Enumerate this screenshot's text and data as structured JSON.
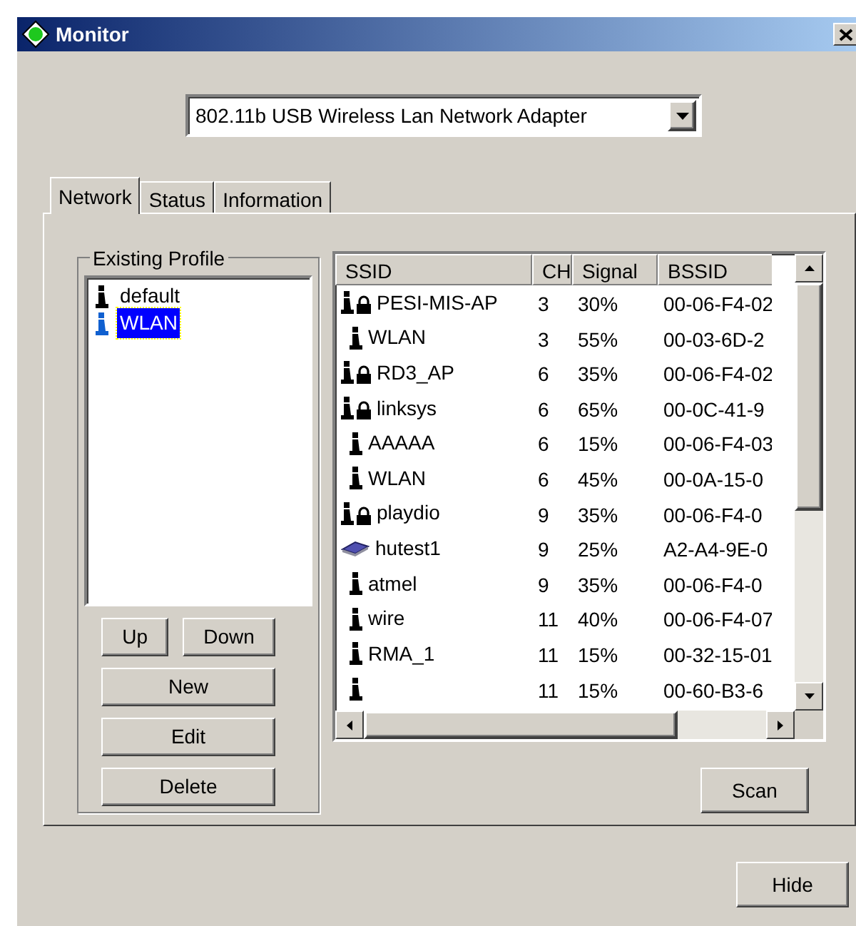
{
  "window": {
    "title": "Monitor"
  },
  "adapter": {
    "value": "802.11b USB Wireless Lan Network Adapter"
  },
  "tabs": [
    {
      "label": "Network",
      "selected": true
    },
    {
      "label": "Status",
      "selected": false
    },
    {
      "label": "Information",
      "selected": false
    }
  ],
  "profiles": {
    "title": "Existing Profile",
    "items": [
      {
        "name": "default",
        "selected": false
      },
      {
        "name": "WLAN",
        "selected": true
      }
    ],
    "buttons": [
      "Up",
      "Down",
      "New",
      "Edit",
      "Delete"
    ]
  },
  "networks": {
    "columns": [
      "SSID",
      "CH",
      "Signal",
      "BSSID"
    ],
    "rows": [
      {
        "kind": "secure",
        "ssid": "PESI-MIS-AP",
        "ch": "3",
        "signal": "30%",
        "bssid": "00-06-F4-02"
      },
      {
        "kind": "open",
        "ssid": "WLAN",
        "ch": "3",
        "signal": "55%",
        "bssid": "00-03-6D-2"
      },
      {
        "kind": "secure",
        "ssid": "RD3_AP",
        "ch": "6",
        "signal": "35%",
        "bssid": "00-06-F4-02"
      },
      {
        "kind": "secure",
        "ssid": "linksys",
        "ch": "6",
        "signal": "65%",
        "bssid": "00-0C-41-9"
      },
      {
        "kind": "open",
        "ssid": "AAAAA",
        "ch": "6",
        "signal": "15%",
        "bssid": "00-06-F4-03"
      },
      {
        "kind": "open",
        "ssid": "WLAN",
        "ch": "6",
        "signal": "45%",
        "bssid": "00-0A-15-0"
      },
      {
        "kind": "secure",
        "ssid": "playdio",
        "ch": "9",
        "signal": "35%",
        "bssid": "00-06-F4-0"
      },
      {
        "kind": "adhoc",
        "ssid": "hutest1",
        "ch": "9",
        "signal": "25%",
        "bssid": "A2-A4-9E-0"
      },
      {
        "kind": "open",
        "ssid": "atmel",
        "ch": "9",
        "signal": "35%",
        "bssid": "00-06-F4-0"
      },
      {
        "kind": "open",
        "ssid": "wire",
        "ch": "11",
        "signal": "40%",
        "bssid": "00-06-F4-07"
      },
      {
        "kind": "open",
        "ssid": "RMA_1",
        "ch": "11",
        "signal": "15%",
        "bssid": "00-32-15-01"
      },
      {
        "kind": "open",
        "ch": "11",
        "signal": "15%",
        "bssid": "00-60-B3-6"
      }
    ]
  },
  "buttons": {
    "scan": "Scan",
    "hide": "Hide"
  }
}
